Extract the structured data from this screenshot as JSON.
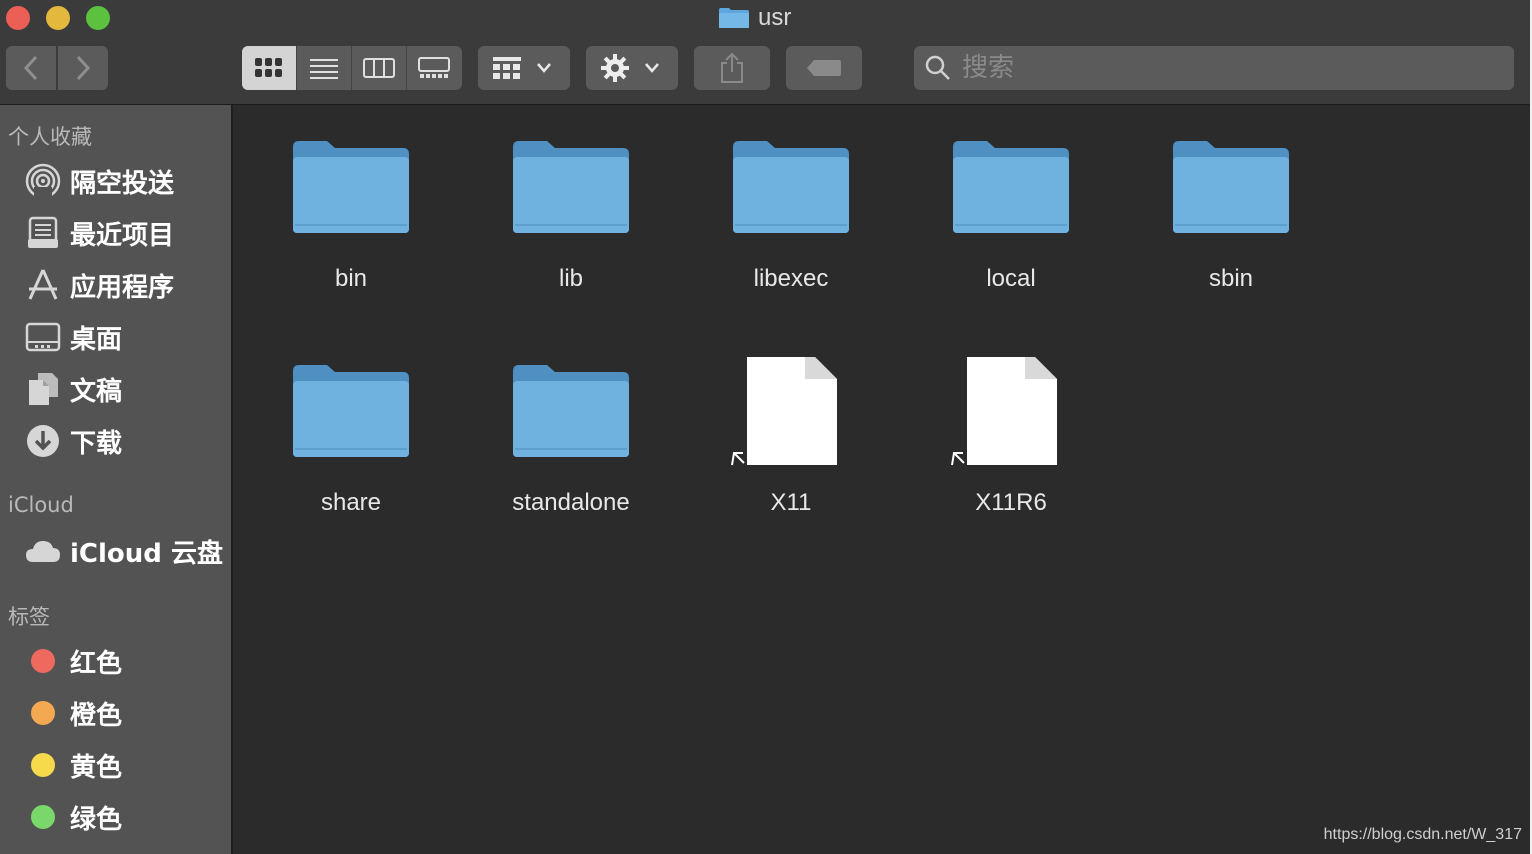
{
  "window": {
    "title": "usr"
  },
  "toolbar": {
    "search_placeholder": "搜索"
  },
  "sidebar": {
    "favorites_title": "个人收藏",
    "favorites": [
      {
        "label": "隔空投送",
        "icon": "airdrop-icon"
      },
      {
        "label": "最近项目",
        "icon": "recents-icon"
      },
      {
        "label": "应用程序",
        "icon": "applications-icon"
      },
      {
        "label": "桌面",
        "icon": "desktop-icon"
      },
      {
        "label": "文稿",
        "icon": "documents-icon"
      },
      {
        "label": "下载",
        "icon": "downloads-icon"
      }
    ],
    "icloud_title": "iCloud",
    "icloud": [
      {
        "label": "iCloud 云盘",
        "icon": "icloud-icon"
      }
    ],
    "tags_title": "标签",
    "tags": [
      {
        "label": "红色",
        "color": "#ee6a5f"
      },
      {
        "label": "橙色",
        "color": "#f4a852"
      },
      {
        "label": "黄色",
        "color": "#f7d94c"
      },
      {
        "label": "绿色",
        "color": "#7ad769"
      }
    ]
  },
  "content": {
    "items": [
      {
        "name": "bin",
        "kind": "folder"
      },
      {
        "name": "lib",
        "kind": "folder"
      },
      {
        "name": "libexec",
        "kind": "folder"
      },
      {
        "name": "local",
        "kind": "folder"
      },
      {
        "name": "sbin",
        "kind": "folder"
      },
      {
        "name": "share",
        "kind": "folder"
      },
      {
        "name": "standalone",
        "kind": "folder"
      },
      {
        "name": "X11",
        "kind": "alias"
      },
      {
        "name": "X11R6",
        "kind": "alias"
      }
    ]
  },
  "watermark": "https://blog.csdn.net/W_317",
  "colors": {
    "folder_blue": "#6fb1df",
    "sidebar_bg": "#535353",
    "content_bg": "#2b2b2b"
  }
}
